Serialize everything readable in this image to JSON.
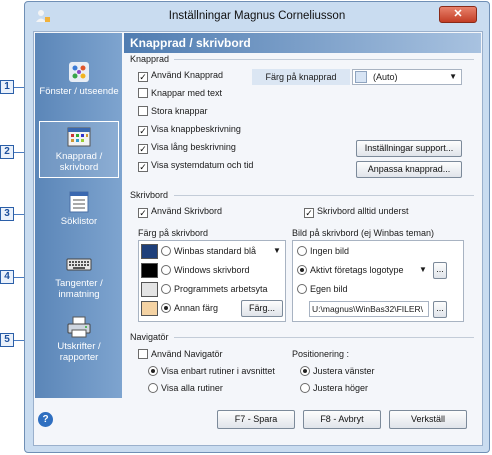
{
  "callouts": [
    "1",
    "2",
    "3",
    "4",
    "5"
  ],
  "window": {
    "title": "Inställningar Magnus Corneliusson",
    "close_label": "✕"
  },
  "sidebar": {
    "items": [
      {
        "label": "Fönster / utseende"
      },
      {
        "label": "Knapprad / skrivbord"
      },
      {
        "label": "Söklistor"
      },
      {
        "label": "Tangenter / inmatning"
      },
      {
        "label": "Utskrifter / rapporter"
      }
    ]
  },
  "header": {
    "title": "Knapprad / skrivbord"
  },
  "knapprad": {
    "title": "Knapprad",
    "anvand": "Använd Knapprad",
    "med_text": "Knappar med text",
    "stora": "Stora knappar",
    "visa_beskr": "Visa knappbeskrivning",
    "visa_lang": "Visa lång beskrivning",
    "visa_datum": "Visa systemdatum och tid",
    "farg_label": "Färg på knapprad",
    "farg_value": "(Auto)",
    "installningar_btn": "Inställningar support...",
    "anpassa_btn": "Anpassa knapprad..."
  },
  "skrivbord": {
    "title": "Skrivbord",
    "anvand": "Använd Skrivbord",
    "alltid_underst": "Skrivbord alltid underst",
    "farg_title": "Färg på skrivbord",
    "farg_options": [
      {
        "label": "Winbas standard blå",
        "color": "#1e3f7a"
      },
      {
        "label": "Windows skrivbord",
        "color": "#000000"
      },
      {
        "label": "Programmets arbetsyta",
        "color": "#e4e4e4"
      },
      {
        "label": "Annan färg",
        "color": "#f5d3a3"
      }
    ],
    "farg_btn": "Färg...",
    "bild_title": "Bild på skrivbord (ej Winbas teman)",
    "bild_options": [
      "Ingen bild",
      "Aktivt företags logotype",
      "Egen bild"
    ],
    "bild_path": "U:\\magnus\\WinBas32\\FILER\\",
    "more_btn": "..."
  },
  "navigator": {
    "title": "Navigatör",
    "anvand": "Använd Navigatör",
    "visa_enbart": "Visa enbart rutiner i avsnittet",
    "visa_alla": "Visa alla rutiner",
    "pos_title": "Positionering :",
    "justera_vanster": "Justera vänster",
    "justera_hoger": "Justera höger"
  },
  "footer": {
    "help": "?",
    "spara": "F7 - Spara",
    "avbryt": "F8 - Avbryt",
    "verkstall": "Verkställ"
  },
  "colors": {
    "accent": "#4f7cb1",
    "sidebar": "#6a93c4"
  }
}
